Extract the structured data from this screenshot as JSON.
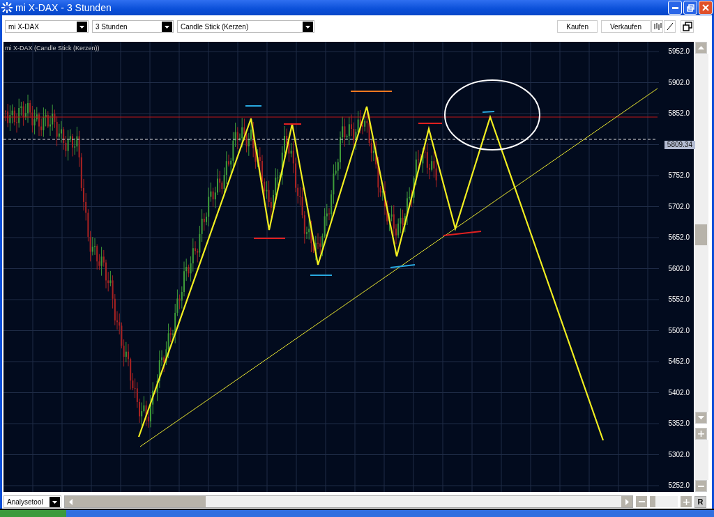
{
  "window": {
    "title": "mi X-DAX - 3 Stunden"
  },
  "toolbar": {
    "dropdowns": [
      "mi X-DAX",
      "3 Stunden",
      "Candle Stick (Kerzen)"
    ],
    "buttons": [
      "Kaufen",
      "Verkaufen"
    ]
  },
  "chart": {
    "label": "mi X-DAX (Candle Stick (Kerzen))",
    "y_axis": {
      "ticks_above": [
        "5952.0",
        "5902.0",
        "5852.0"
      ],
      "price_tag": "5809.34",
      "ticks_below": [
        "5752.0",
        "5702.0",
        "5652.0",
        "5602.0",
        "5552.0",
        "5502.0",
        "5452.0",
        "5402.0",
        "5352.0",
        "5302.0",
        "5252.0"
      ]
    }
  },
  "bottom_bar": {
    "dropdown": "Analysetool",
    "zoom": {
      "level": 0
    },
    "reset_button": "R"
  }
}
